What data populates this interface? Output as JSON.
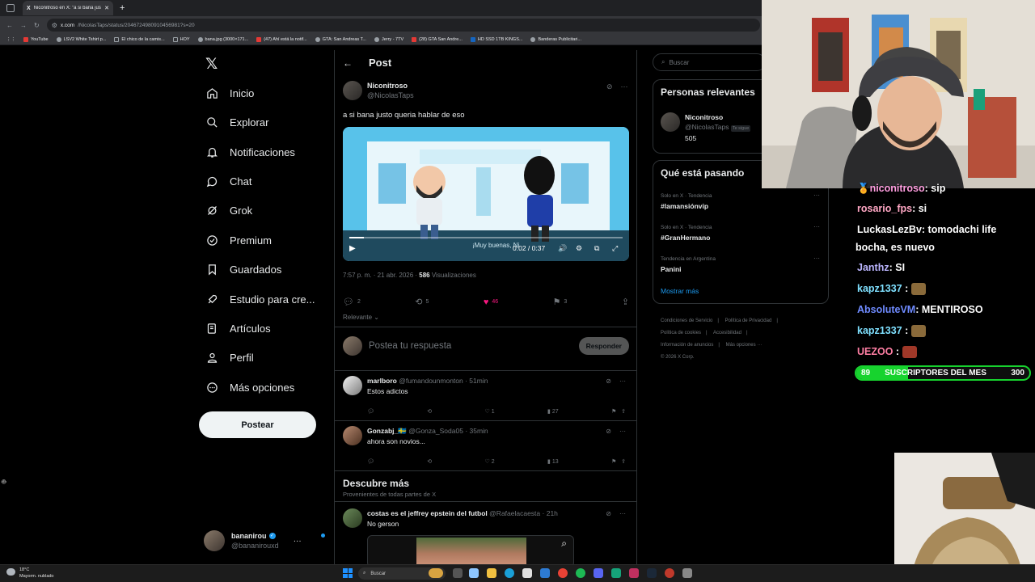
{
  "browser": {
    "tab_title": "Niconitroso en X: \"a si bana justo...",
    "url_domain": "x.com",
    "url_path": "/NicolasTaps/status/2046724980910456981?s=20",
    "bookmarks": [
      "YouTube",
      "LSV2 White Tshirt p...",
      "El chico de la camis...",
      "HOY",
      "bana.jpg (3000×171...",
      "(47) Ahí está la notif...",
      "GTA: San Andreas T...",
      "Jerry - 7TV",
      "(28) GTA San Andre...",
      "HD SSD 1TB KINGS...",
      "Banderas Publicitari..."
    ]
  },
  "nav": {
    "items": [
      "Inicio",
      "Explorar",
      "Notificaciones",
      "Chat",
      "Grok",
      "Premium",
      "Guardados",
      "Estudio para cre...",
      "Artículos",
      "Perfil",
      "Más opciones"
    ],
    "post_button": "Postear",
    "user": {
      "name": "bananirou",
      "handle": "@bananirouxd"
    }
  },
  "post": {
    "header": "Post",
    "author_name": "Niconitroso",
    "author_handle": "@NicolasTaps",
    "text": "a si bana justo queria hablar de eso",
    "video": {
      "subtitle": "¡Muy buenas, Ni",
      "time": "0:02 / 0:37",
      "progress": 0.054
    },
    "timestamp": "7:57 p. m. · 21 abr. 2026 · ",
    "views_count": "586",
    "views_label": " Visualizaciones",
    "counts": {
      "replies": "2",
      "reposts": "5",
      "likes": "46",
      "bookmarks": "3"
    },
    "relevant_label": "Relevante",
    "reply_placeholder": "Postea tu respuesta",
    "reply_button": "Responder"
  },
  "comments": [
    {
      "name": "marlboro",
      "handle": "@fumandounmonton",
      "time": "· 51min",
      "text": "Estos adictos",
      "likes": "1",
      "views": "27"
    },
    {
      "name": "Gonzabj_🇸🇪",
      "handle": "@Gonza_Soda05",
      "time": "· 35min",
      "text": "ahora son novios...",
      "likes": "2",
      "views": "13"
    }
  ],
  "discover": {
    "title": "Descubre más",
    "subtitle": "Provenientes de todas partes de X",
    "post": {
      "name": "costas es el jeffrey epstein del futbol",
      "handle": "@Rafaelacaesta",
      "time": "· 21h",
      "text": "No gerson"
    }
  },
  "sidebar": {
    "search_placeholder": "Buscar",
    "people_title": "Personas relevantes",
    "person": {
      "name": "Niconitroso",
      "handle": "@NicolasTaps",
      "follows_you": "Te sigue",
      "count": "505"
    },
    "trends_title": "Qué está pasando",
    "trends": [
      {
        "context": "Solo en X · Tendencia",
        "name": "#lamansiónvip"
      },
      {
        "context": "Solo en X · Tendencia",
        "name": "#GranHermano"
      },
      {
        "context": "Tendencia en Argentina",
        "name": "Panini"
      }
    ],
    "show_more": "Mostrar más",
    "footer": [
      "Condiciones de Servicio",
      "Política de Privacidad",
      "Política de cookies",
      "Accesibilidad",
      "Información de anuncios",
      "Más opciones ···",
      "© 2026 X Corp."
    ]
  },
  "stream": {
    "chat": [
      {
        "user": "niconitroso",
        "text": ": sip"
      },
      {
        "user": "rosario_fps",
        "text": ": si"
      },
      {
        "user": "LuckasLezBv",
        "text": ": tomodachi life"
      },
      {
        "user": "",
        "text": "bocha, es nuevo"
      },
      {
        "user": "Janthz",
        "text": ": SI"
      },
      {
        "user": "kapz1337",
        "text": " :"
      },
      {
        "user": "AbsoluteVM",
        "text": ": MENTIROSO"
      },
      {
        "user": "kapz1337",
        "text": " :"
      },
      {
        "user": "UEZOO",
        "text": " :"
      }
    ],
    "sub_goal": {
      "current": "89",
      "label": "SUSCRIPTORES DEL MES",
      "goal": "300",
      "fraction": 0.297
    }
  },
  "taskbar": {
    "temp": "18°C",
    "weather": "Mayorm. nublado",
    "search": "Buscar"
  }
}
